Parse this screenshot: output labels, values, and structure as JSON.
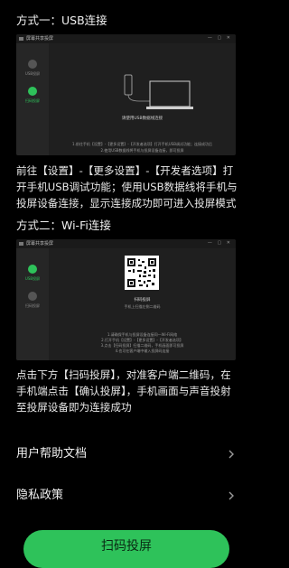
{
  "usb_section": {
    "title": "方式一：USB连接",
    "screenshot": {
      "app_title": "屏幕共享投屏",
      "window_controls": "— ▢ ✕",
      "sidebar": [
        {
          "label": "USB投屏",
          "icon": "usb-icon"
        },
        {
          "label": "扫码投屏",
          "icon": "qrcode-icon"
        }
      ],
      "heading": "请使用USB数据线连接",
      "hint_line1": "1.前往手机【设置】-【更多设置】-【开发者选项】打开手机USB调试功能；连接成功后",
      "hint_line2": "2.使用USB数据线将手机与投屏设备连接，即可投屏"
    },
    "description": "前往【设置】-【更多设置】-【开发者选项】打开手机USB调试功能；使用USB数据线将手机与投屏设备连接，显示连接成功即可进入投屏模式"
  },
  "wifi_section": {
    "title": "方式二：Wi-Fi连接",
    "screenshot": {
      "app_title": "屏幕共享投屏",
      "window_controls": "— ▢ ✕",
      "sidebar": [
        {
          "label": "USB投屏",
          "icon": "usb-icon"
        },
        {
          "label": "扫码投屏",
          "icon": "qrcode-icon"
        }
      ],
      "heading": "扫码投屏",
      "subheading": "手机上扫描左侧二维码",
      "hint_line1": "1.请确保手机与投屏设备连接同一Wi-Fi网络",
      "hint_line2": "2.打开手机【设置】-【更多设置】-【开发者选项】",
      "hint_line3": "3.点击【扫码投屏】扫描二维码，手机画面即可投屏",
      "hint_line4": "4.也可在客户端中输入投屏码连接"
    },
    "description": "点击下方【扫码投屏】，对准客户端二维码，在手机端点击【确认投屏】，手机画面与声音投射至投屏设备即为连接成功"
  },
  "menu": [
    {
      "label": "用户帮助文档",
      "icon": "chevron-right-icon"
    },
    {
      "label": "隐私政策",
      "icon": "chevron-right-icon"
    }
  ],
  "primary_button": {
    "label": "扫码投屏"
  },
  "colors": {
    "accent": "#2ec25a",
    "background": "#000000"
  }
}
